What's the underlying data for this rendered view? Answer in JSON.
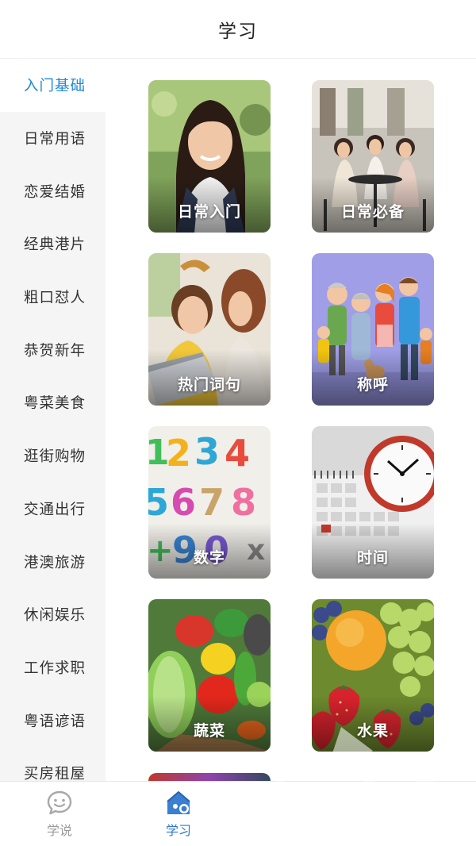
{
  "header": {
    "title": "学习"
  },
  "sidebar": {
    "items": [
      {
        "label": "入门基础",
        "active": true
      },
      {
        "label": "日常用语"
      },
      {
        "label": "恋爱结婚"
      },
      {
        "label": "经典港片"
      },
      {
        "label": "粗口怼人"
      },
      {
        "label": "恭贺新年"
      },
      {
        "label": "粤菜美食"
      },
      {
        "label": "逛街购物"
      },
      {
        "label": "交通出行"
      },
      {
        "label": "港澳旅游"
      },
      {
        "label": "休闲娱乐"
      },
      {
        "label": "工作求职"
      },
      {
        "label": "粤语谚语"
      },
      {
        "label": "买房租屋"
      }
    ]
  },
  "cards": [
    {
      "label": "日常入门",
      "image": "woman-portrait"
    },
    {
      "label": "日常必备",
      "image": "women-cafe"
    },
    {
      "label": "热门词句",
      "image": "women-laptop"
    },
    {
      "label": "称呼",
      "image": "family-cartoon"
    },
    {
      "label": "数字",
      "image": "number-toys"
    },
    {
      "label": "时间",
      "image": "clock-calendar"
    },
    {
      "label": "蔬菜",
      "image": "vegetables"
    },
    {
      "label": "水果",
      "image": "fruits"
    }
  ],
  "tabbar": {
    "tabs": [
      {
        "label": "学说",
        "icon": "chat-smile-icon",
        "active": false
      },
      {
        "label": "学习",
        "icon": "home-learn-icon",
        "active": true
      }
    ]
  },
  "colors": {
    "accent": "#1e88d8",
    "tab_active": "#2f78c9",
    "sidebar_bg": "#f5f5f5"
  }
}
